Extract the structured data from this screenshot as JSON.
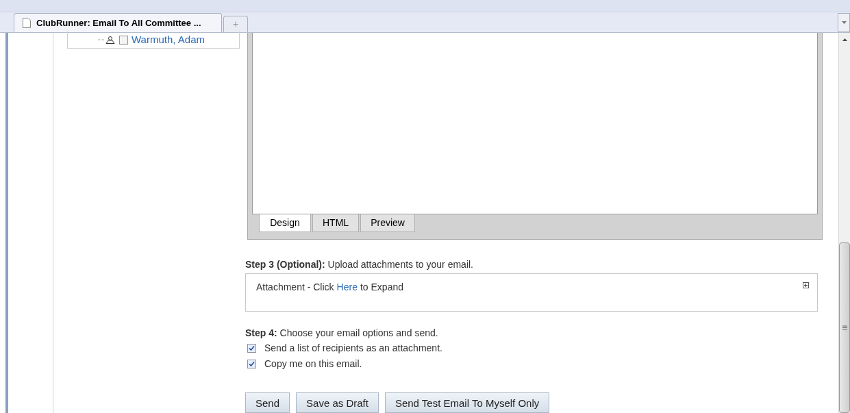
{
  "browser": {
    "tab_title": "ClubRunner: Email To All Committee ...",
    "new_tab": "+"
  },
  "tree": {
    "items": [
      {
        "label": "Warmuth, Adam",
        "checked": false
      }
    ]
  },
  "editor": {
    "tabs": [
      {
        "label": "Design",
        "selected": true
      },
      {
        "label": "HTML",
        "selected": false
      },
      {
        "label": "Preview",
        "selected": false
      }
    ]
  },
  "step3": {
    "text": "**Step 3 (Optional):** Upload attachments to your email.",
    "attachment": {
      "before": "Attachment - Click",
      "link": "Here",
      "after": "to Expand"
    }
  },
  "step4": {
    "text": "**Step 4:** Choose your email options and send.",
    "options": [
      {
        "label": "Send a list of recipients as an attachment.",
        "checked": true
      },
      {
        "label": "Copy me on this email.",
        "checked": true
      }
    ]
  },
  "buttons": [
    "Send",
    "Save as Draft",
    "Send Test Email To Myself Only"
  ]
}
